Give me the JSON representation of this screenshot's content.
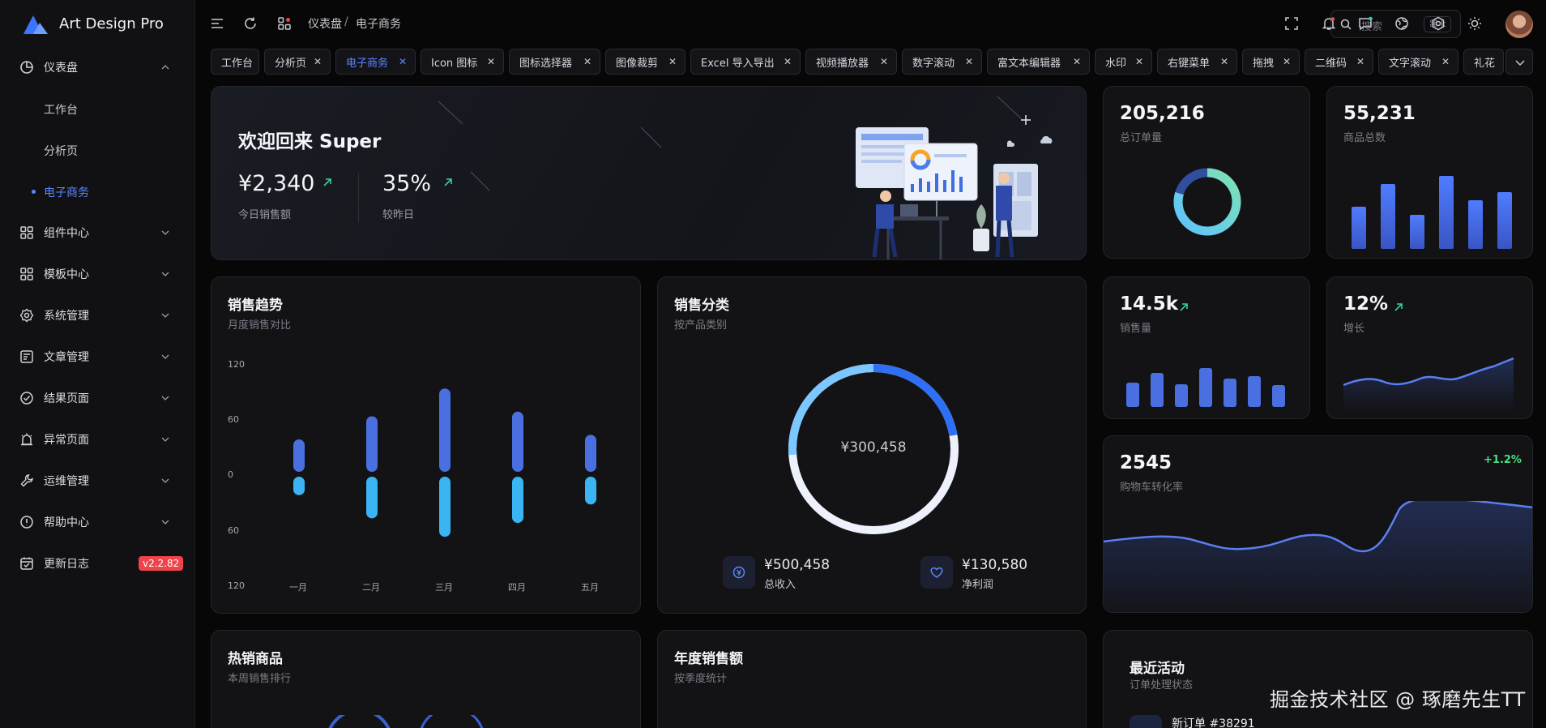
{
  "app": {
    "brand": "Art Design Pro",
    "version_badge": "v2.2.82"
  },
  "sidebar": {
    "items": [
      {
        "label": "仪表盘",
        "icon": "pie-chart-icon"
      },
      {
        "label": "组件中心",
        "icon": "grid-icon"
      },
      {
        "label": "模板中心",
        "icon": "grid-icon"
      },
      {
        "label": "系统管理",
        "icon": "gear-icon"
      },
      {
        "label": "文章管理",
        "icon": "article-icon"
      },
      {
        "label": "结果页面",
        "icon": "check-circle-icon"
      },
      {
        "label": "异常页面",
        "icon": "alarm-icon"
      },
      {
        "label": "运维管理",
        "icon": "wrench-icon"
      },
      {
        "label": "帮助中心",
        "icon": "info-circle-icon"
      },
      {
        "label": "更新日志",
        "icon": "calendar-check-icon"
      }
    ],
    "sub_items": [
      "工作台",
      "分析页",
      "电子商务"
    ]
  },
  "topbar": {
    "breadcrumb": [
      "仪表盘",
      "电子商务"
    ],
    "breadcrumb_sep": "/",
    "search_placeholder": "搜索",
    "search_shortcut": "⌘ k"
  },
  "tabs": [
    "工作台",
    "分析页",
    "电子商务",
    "Icon 图标",
    "图标选择器",
    "图像裁剪",
    "Excel 导入导出",
    "视频播放器",
    "数字滚动",
    "富文本编辑器",
    "水印",
    "右键菜单",
    "拖拽",
    "二维码",
    "文字滚动",
    "礼花"
  ],
  "welcome": {
    "title": "欢迎回来 Super",
    "sales_value": "¥2,340",
    "sales_label": "今日销售额",
    "growth_value": "35%",
    "growth_label": "较昨日"
  },
  "stats": {
    "orders": {
      "value": "205,216",
      "label": "总订单量"
    },
    "products": {
      "value": "55,231",
      "label": "商品总数"
    },
    "sales": {
      "value": "14.5k",
      "label": "销售量"
    },
    "growth": {
      "value": "12%",
      "label": "增长"
    },
    "cart": {
      "value": "2545",
      "label": "购物车转化率",
      "change": "+1.2%"
    }
  },
  "sales_trend": {
    "title": "销售趋势",
    "subtitle": "月度销售对比",
    "chart_data": {
      "type": "bar",
      "categories": [
        "一月",
        "二月",
        "三月",
        "四月",
        "五月"
      ],
      "y_tick_labels": [
        "120",
        "60",
        "0",
        "60",
        "120"
      ],
      "series": [
        {
          "values": [
            35,
            60,
            90,
            65,
            40
          ]
        },
        {
          "values": [
            -20,
            -45,
            -65,
            -50,
            -30
          ]
        }
      ],
      "ylim": [
        -120,
        120
      ]
    }
  },
  "sales_category": {
    "title": "销售分类",
    "subtitle": "按产品类别",
    "center_value": "¥300,458",
    "income_value": "¥500,458",
    "income_label": "总收入",
    "profit_value": "¥130,580",
    "profit_label": "净利润"
  },
  "hot_products": {
    "title": "热销商品",
    "subtitle": "本周销售排行"
  },
  "annual_sales": {
    "title": "年度销售额",
    "subtitle": "按季度统计"
  },
  "recent_activity": {
    "title": "最近活动",
    "subtitle": "订单处理状态",
    "first_item": "新订单 #38291"
  },
  "watermark": "掘金技术社区 @ 琢磨先生TT",
  "colors": {
    "accent": "#5b86ff",
    "bar_blue": "#4a6fe0",
    "bar_cyan": "#3ab4f2",
    "positive": "#34d399",
    "badge_red": "#f0444b"
  }
}
